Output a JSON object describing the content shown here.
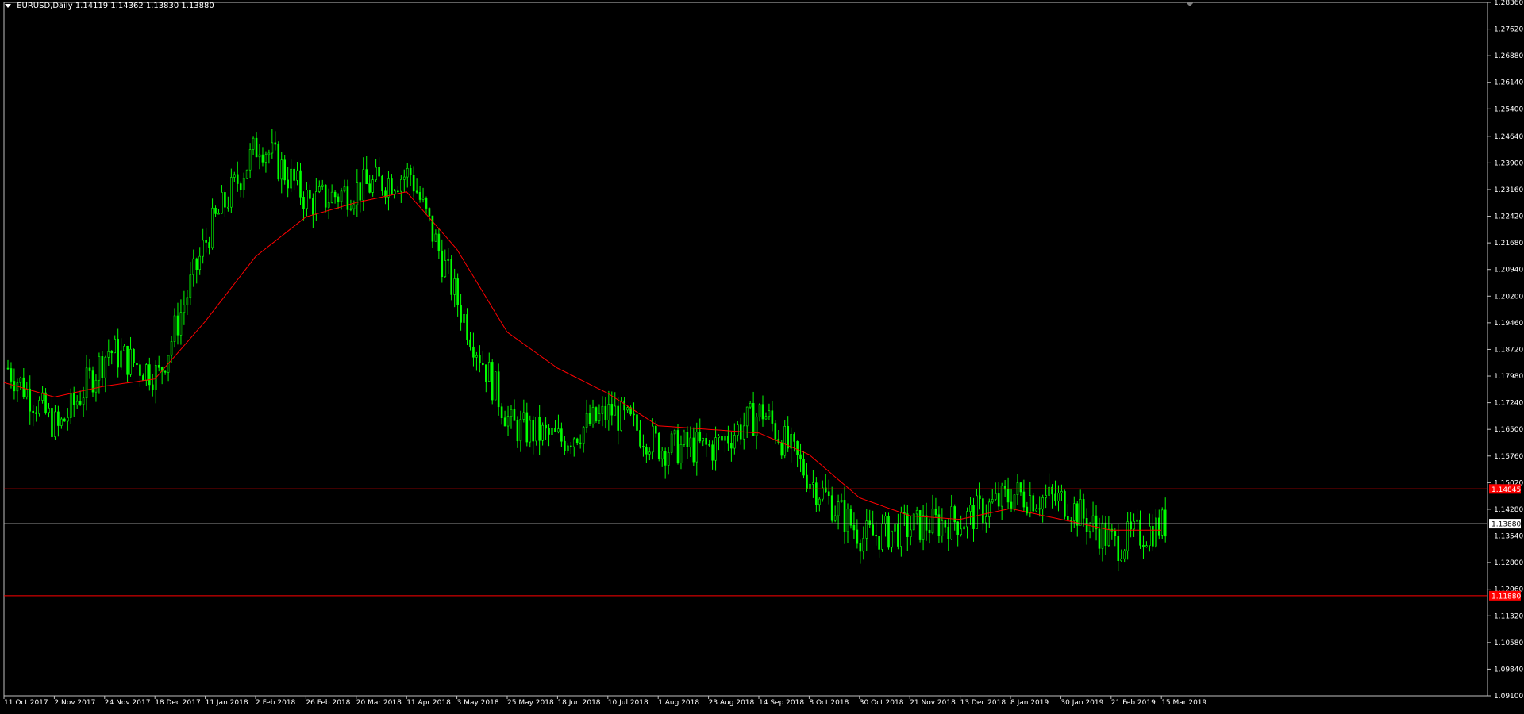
{
  "symbol_header": {
    "label": "EURUSD,Daily",
    "ohlc": "1.14119 1.14362 1.13830 1.13880"
  },
  "colors": {
    "background": "#000000",
    "axis": "#c0c0c0",
    "text": "#ffffff",
    "candle": "#00ff00",
    "moving_average": "#ff0000",
    "level_line": "#ff0000",
    "bid_line": "#c0c0c0",
    "price_tag_red_bg": "#ff0000",
    "price_tag_bid_bg": "#ffffff"
  },
  "chart_data": {
    "type": "candlestick",
    "title": "EURUSD,Daily",
    "ylim": [
      1.091,
      1.2836
    ],
    "y_ticks": [
      "1.28360",
      "1.27620",
      "1.26880",
      "1.26140",
      "1.25400",
      "1.24640",
      "1.23900",
      "1.23160",
      "1.22420",
      "1.21680",
      "1.20940",
      "1.20200",
      "1.19460",
      "1.18720",
      "1.17980",
      "1.17240",
      "1.16500",
      "1.15760",
      "1.15020",
      "1.14280",
      "1.13540",
      "1.12800",
      "1.12060",
      "1.11320",
      "1.10580",
      "1.09840",
      "1.09100"
    ],
    "x_ticks": [
      "11 Oct 2017",
      "2 Nov 2017",
      "24 Nov 2017",
      "18 Dec 2017",
      "11 Jan 2018",
      "2 Feb 2018",
      "26 Feb 2018",
      "20 Mar 2018",
      "11 Apr 2018",
      "3 May 2018",
      "25 May 2018",
      "18 Jun 2018",
      "10 Jul 2018",
      "1 Aug 2018",
      "23 Aug 2018",
      "14 Sep 2018",
      "8 Oct 2018",
      "30 Oct 2018",
      "21 Nov 2018",
      "13 Dec 2018",
      "8 Jan 2019",
      "30 Jan 2019",
      "21 Feb 2019",
      "15 Mar 2019"
    ],
    "close_path": [
      [
        "11 Oct 2017",
        1.182
      ],
      [
        "2 Nov 2017",
        1.165
      ],
      [
        "24 Nov 2017",
        1.187
      ],
      [
        "18 Dec 2017",
        1.18
      ],
      [
        "11 Jan 2018",
        1.22
      ],
      [
        "2 Feb 2018",
        1.245
      ],
      [
        "26 Feb 2018",
        1.228
      ],
      [
        "20 Mar 2018",
        1.232
      ],
      [
        "11 Apr 2018",
        1.236
      ],
      [
        "3 May 2018",
        1.198
      ],
      [
        "25 May 2018",
        1.166
      ],
      [
        "18 Jun 2018",
        1.162
      ],
      [
        "10 Jul 2018",
        1.17
      ],
      [
        "1 Aug 2018",
        1.16
      ],
      [
        "23 Aug 2018",
        1.16
      ],
      [
        "14 Sep 2018",
        1.17
      ],
      [
        "8 Oct 2018",
        1.15
      ],
      [
        "30 Oct 2018",
        1.135
      ],
      [
        "21 Nov 2018",
        1.138
      ],
      [
        "13 Dec 2018",
        1.14
      ],
      [
        "8 Jan 2019",
        1.147
      ],
      [
        "30 Jan 2019",
        1.145
      ],
      [
        "21 Feb 2019",
        1.133
      ],
      [
        "15 Mar 2019",
        1.1388
      ]
    ],
    "moving_average_path": [
      [
        "11 Oct 2017",
        1.178
      ],
      [
        "2 Nov 2017",
        1.174
      ],
      [
        "24 Nov 2017",
        1.177
      ],
      [
        "18 Dec 2017",
        1.179
      ],
      [
        "11 Jan 2018",
        1.195
      ],
      [
        "2 Feb 2018",
        1.213
      ],
      [
        "26 Feb 2018",
        1.224
      ],
      [
        "20 Mar 2018",
        1.228
      ],
      [
        "11 Apr 2018",
        1.231
      ],
      [
        "3 May 2018",
        1.215
      ],
      [
        "25 May 2018",
        1.192
      ],
      [
        "18 Jun 2018",
        1.182
      ],
      [
        "10 Jul 2018",
        1.175
      ],
      [
        "1 Aug 2018",
        1.166
      ],
      [
        "23 Aug 2018",
        1.165
      ],
      [
        "14 Sep 2018",
        1.164
      ],
      [
        "8 Oct 2018",
        1.158
      ],
      [
        "30 Oct 2018",
        1.146
      ],
      [
        "21 Nov 2018",
        1.141
      ],
      [
        "13 Dec 2018",
        1.14
      ],
      [
        "8 Jan 2019",
        1.143
      ],
      [
        "30 Jan 2019",
        1.14
      ],
      [
        "21 Feb 2019",
        1.137
      ],
      [
        "15 Mar 2019",
        1.137
      ]
    ],
    "horizontal_levels": [
      {
        "value": 1.14845,
        "label": "1.14845"
      },
      {
        "value": 1.1188,
        "label": "1.11880"
      }
    ],
    "bid_line": {
      "value": 1.1388,
      "label": "1.13880"
    }
  }
}
